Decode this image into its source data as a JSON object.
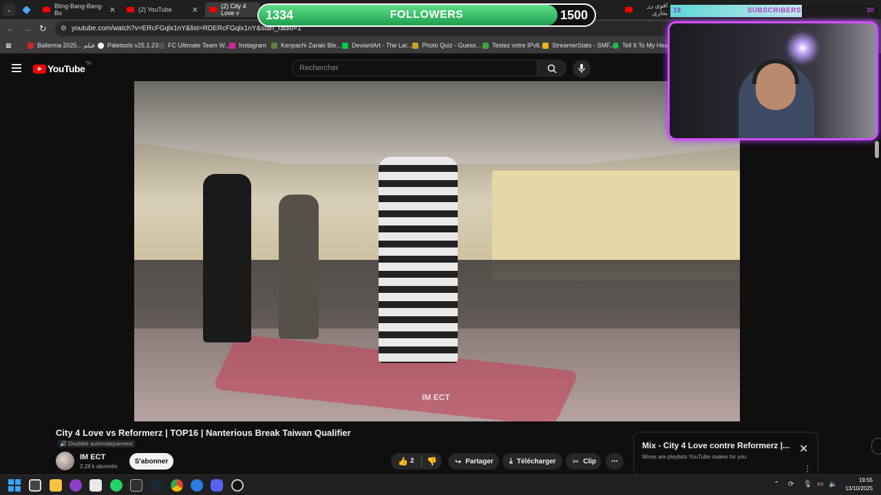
{
  "browser": {
    "tabs": [
      {
        "label": "",
        "kind": "gem"
      },
      {
        "label": "Bling-Bang-Bang-Bo"
      },
      {
        "label": "(2) YouTube"
      },
      {
        "label": "(2) City 4 Love v",
        "active": true
      },
      {
        "label": "اقوى رز بخاري",
        "rtl": true
      }
    ],
    "url": "youtube.com/watch?v=ERcFGqlx1nY&list=RDERcFGqlx1nY&start_radio=1",
    "bookmarks": [
      {
        "label": "Ballerina 2025... فيلم",
        "color": "#c62828"
      },
      {
        "label": "Paletools v25.1.23",
        "color": "#ffffff"
      },
      {
        "label": "FC Ultimate Team W...",
        "color": "#555555"
      },
      {
        "label": "Instagram",
        "color": "#d6249f"
      },
      {
        "label": "Kenpachi Zaraki Ble...",
        "color": "#5c7f3e"
      },
      {
        "label": "DeviantArt - The Lar...",
        "color": "#05cc47"
      },
      {
        "label": "Photo Quiz - Guess...",
        "color": "#c9a227"
      },
      {
        "label": "Testez votre IPv6.",
        "color": "#43a047"
      },
      {
        "label": "StreamerStats - SMF...",
        "color": "#f2b31f"
      },
      {
        "label": "Tell It To My Heart",
        "color": "#1db954"
      }
    ]
  },
  "youtube": {
    "logo_word": "YouTube",
    "logo_region": "TN",
    "search_placeholder": "Rechercher",
    "video_watermark": "IM ECT",
    "video_title": "City 4 Love vs Reformerz | TOP16 | Nanterious Break Taiwan Qualifier",
    "dub_badge": "Doublée automatiquement",
    "channel_name": "IM ECT",
    "subscriber_count": "2,28 k abonnés",
    "subscribe_label": "S'abonner",
    "like_count": "2",
    "share_label": "Partager",
    "download_label": "Télécharger",
    "clip_label": "Clip",
    "more_label": "⋯",
    "mix_title": "Mix - City 4 Love contre Reformerz |...",
    "mix_subtitle": "Mixes are playlists YouTube makes for you"
  },
  "overlay": {
    "followers_current": "1334",
    "followers_label": "FOLLOWERS",
    "followers_goal": "1500",
    "followers_progress": 0.889,
    "followers_color": "#2fbf64",
    "subscribers_current": "19",
    "subscribers_label": "SUBSCRIBERS",
    "subscribers_goal": "30",
    "subscribers_progress": 0.633,
    "webcam_border_color": "#d24fff"
  },
  "taskbar": {
    "time": "19:55",
    "date": "13/10/2025"
  }
}
